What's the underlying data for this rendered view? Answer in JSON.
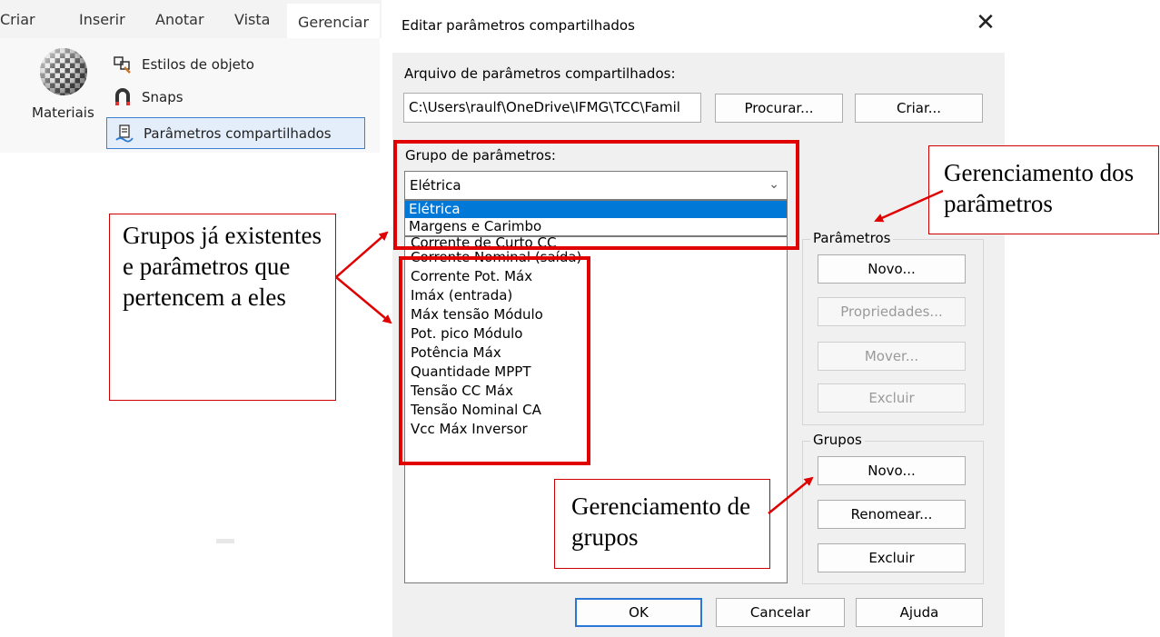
{
  "ribbon": {
    "tabs": [
      "Criar",
      "Inserir",
      "Anotar",
      "Vista",
      "Gerenciar"
    ],
    "active_tab": "Gerenciar",
    "materiais_label": "Materiais",
    "items": [
      "Estilos de objeto",
      "Snaps",
      "Parâmetros compartilhados"
    ]
  },
  "dialog": {
    "title": "Editar parâmetros compartilhados",
    "close_glyph": "✕",
    "file_label": "Arquivo de parâmetros compartilhados:",
    "file_path": "C:\\Users\\raulf\\OneDrive\\IFMG\\TCC\\Famil",
    "browse_button": "Procurar...",
    "create_button": "Criar...",
    "group_label": "Grupo de parâmetros:",
    "group_selected": "Elétrica",
    "group_options": [
      "Elétrica",
      "Margens e Carimbo"
    ],
    "parameters": [
      "Corrente de Curto CC",
      "Corrente Nominal (saída)",
      "Corrente Pot. Máx",
      "Imáx (entrada)",
      "Máx tensão Módulo",
      "Pot. pico Módulo",
      "Potência Máx",
      "Quantidade MPPT",
      "Tensão CC Máx",
      "Tensão Nominal CA",
      "Vcc Máx Inversor"
    ],
    "params_group_title": "Parâmetros",
    "params_buttons": {
      "new": "Novo...",
      "properties": "Propriedades...",
      "move": "Mover...",
      "delete": "Excluir"
    },
    "groups_group_title": "Grupos",
    "groups_buttons": {
      "new": "Novo...",
      "rename": "Renomear...",
      "delete": "Excluir"
    },
    "footer": {
      "ok": "OK",
      "cancel": "Cancelar",
      "help": "Ajuda"
    }
  },
  "annotations": {
    "left_callout": "Grupos já existentes e parâmetros que pertencem a eles",
    "right_callout": "Gerenciamento dos parâmetros",
    "bottom_callout": "Gerenciamento de grupos",
    "colors": {
      "red": "#e00000",
      "arrow": "#e00000",
      "selection": "#0078d7"
    }
  }
}
